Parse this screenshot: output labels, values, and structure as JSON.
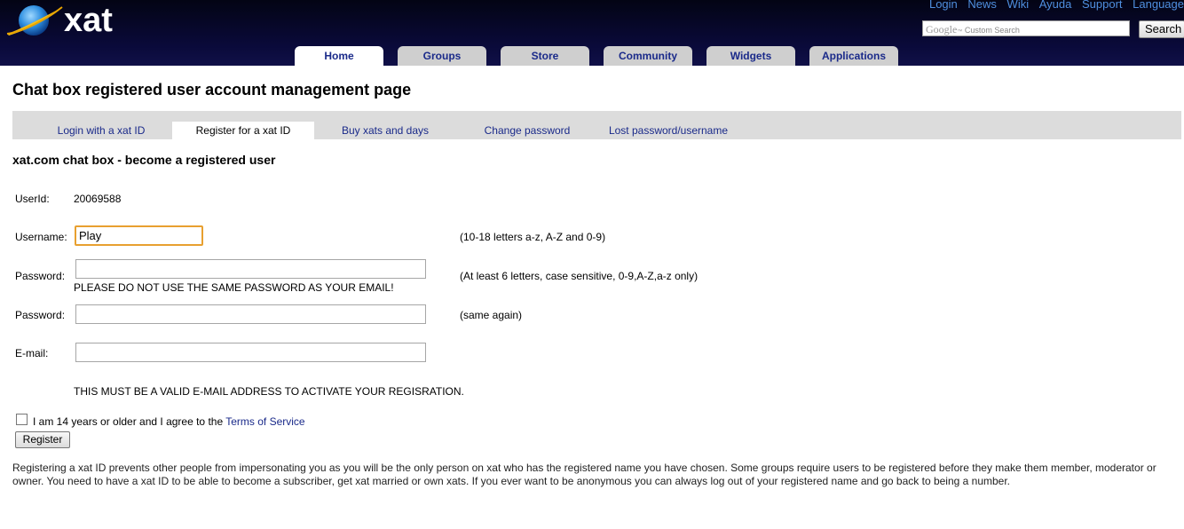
{
  "header": {
    "logo_text": "xat",
    "top_links": [
      "Login",
      "News",
      "Wiki",
      "Ayuda",
      "Support",
      "Language"
    ],
    "search": {
      "brand": "Google",
      "placeholder": "Custom Search",
      "button": "Search"
    },
    "nav_tabs": [
      {
        "label": "Home",
        "active": true
      },
      {
        "label": "Groups",
        "active": false
      },
      {
        "label": "Store",
        "active": false
      },
      {
        "label": "Community",
        "active": false
      },
      {
        "label": "Widgets",
        "active": false
      },
      {
        "label": "Applications",
        "active": false
      }
    ]
  },
  "page_title": "Chat box registered user account management page",
  "sub_tabs": [
    {
      "label": "Login with a xat ID",
      "active": false
    },
    {
      "label": "Register for a xat ID",
      "active": true
    },
    {
      "label": "Buy xats and days",
      "active": false
    },
    {
      "label": "Change password",
      "active": false
    },
    {
      "label": "Lost password/username",
      "active": false
    }
  ],
  "section_title": "xat.com chat box - become a registered user",
  "form": {
    "userid_label": "UserId:",
    "userid_value": "20069588",
    "username_label": "Username:",
    "username_value": "Play",
    "username_hint": "(10-18 letters a-z, A-Z and 0-9)",
    "password_label": "Password:",
    "password_hint": "(At least 6 letters, case sensitive, 0-9,A-Z,a-z only)",
    "password_warning": "PLEASE DO NOT USE THE SAME PASSWORD AS YOUR EMAIL!",
    "password2_label": "Password:",
    "password2_hint": "(same again)",
    "email_label": "E-mail:",
    "email_warning": "THIS MUST BE A VALID E-MAIL ADDRESS TO ACTIVATE YOUR REGISRATION.",
    "agree_text": "I am 14 years or older and I agree to the",
    "terms_link": "Terms of Service",
    "agree_checked": false,
    "register_button": "Register"
  },
  "info_text": "Registering a xat ID prevents other people from impersonating you as you will be the only person on xat who has the registered name you have chosen. Some groups require users to be registered before they make them member, moderator or owner. You need to have a xat ID to be able to become a subscriber, get xat married or own xats. If you ever want to be anonymous you can always log out of your registered name and go back to being a number.",
  "colors": {
    "header_bg": "#0a0a3a",
    "link": "#1a2a8a",
    "toplink": "#4f8fdf",
    "focus": "#e8a030"
  }
}
